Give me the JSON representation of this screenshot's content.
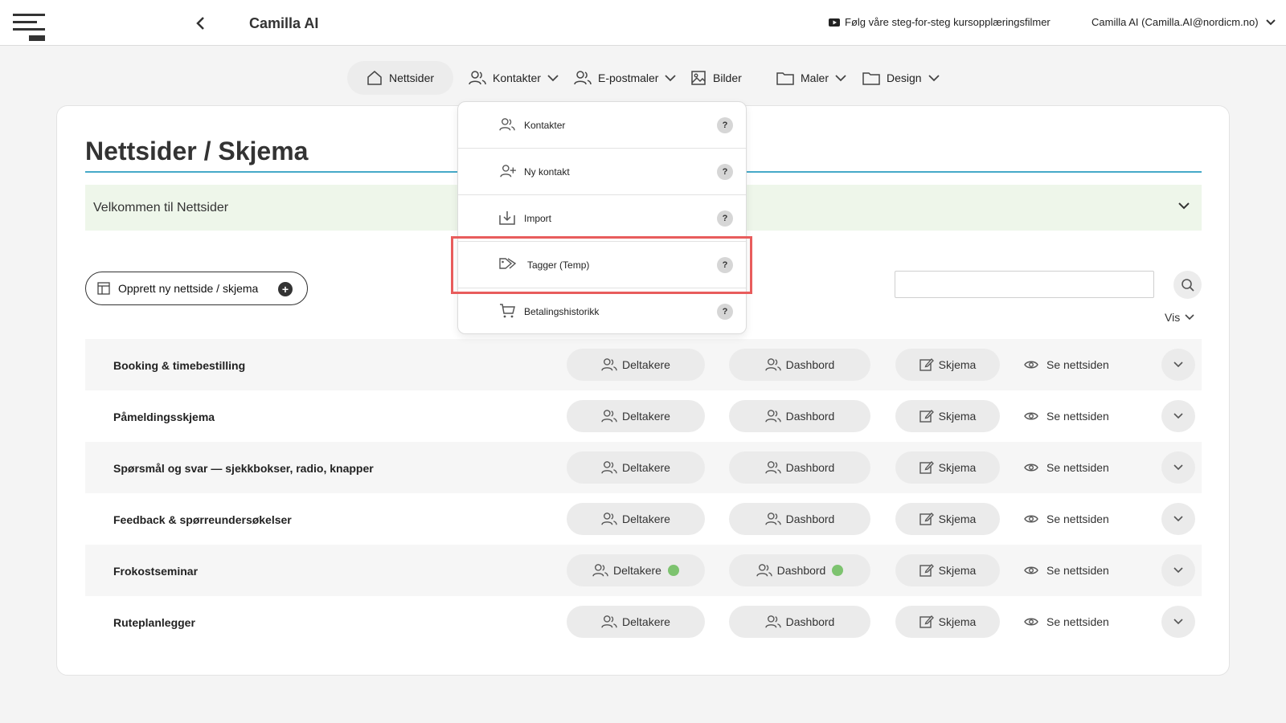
{
  "header": {
    "app_title": "Camilla AI",
    "tutorial_link": "Følg våre steg-for-steg kursopplæringsfilmer",
    "user_label": "Camilla AI (Camilla.AI@nordicm.no)"
  },
  "nav": {
    "items": [
      {
        "label": "Nettsider",
        "icon": "home-icon"
      },
      {
        "label": "Kontakter",
        "icon": "users-icon"
      },
      {
        "label": "E-postmaler",
        "icon": "users-icon"
      },
      {
        "label": "Bilder",
        "icon": "image-icon"
      },
      {
        "label": "Maler",
        "icon": "folder-icon"
      },
      {
        "label": "Design",
        "icon": "folder-icon"
      }
    ]
  },
  "dropdown": {
    "items": [
      {
        "label": "Kontakter",
        "icon": "users-icon",
        "help": "?"
      },
      {
        "label": "Ny kontakt",
        "icon": "user-plus-icon",
        "help": "?"
      },
      {
        "label": "Import",
        "icon": "import-icon",
        "help": "?"
      },
      {
        "label": "Tagger (Temp)",
        "icon": "tags-icon",
        "help": "?"
      },
      {
        "label": "Betalingshistorikk",
        "icon": "cart-icon",
        "help": "?"
      }
    ]
  },
  "main": {
    "title": "Nettsider / Skjema",
    "welcome": "Velkommen til Nettsider",
    "create_button": "Opprett ny nettside / skjema",
    "search_value": "",
    "vis_label": "Vis"
  },
  "rows": [
    {
      "name": "Booking & timebestilling",
      "deltakere": "Deltakere",
      "dashbord": "Dashbord",
      "skjema": "Skjema",
      "view": "Se nettsiden",
      "active_dots": false
    },
    {
      "name": "Påmeldingsskjema",
      "deltakere": "Deltakere",
      "dashbord": "Dashbord",
      "skjema": "Skjema",
      "view": "Se nettsiden",
      "active_dots": false
    },
    {
      "name": "Spørsmål og svar — sjekkbokser, radio, knapper",
      "deltakere": "Deltakere",
      "dashbord": "Dashbord",
      "skjema": "Skjema",
      "view": "Se nettsiden",
      "active_dots": false
    },
    {
      "name": "Feedback & spørreundersøkelser",
      "deltakere": "Deltakere",
      "dashbord": "Dashbord",
      "skjema": "Skjema",
      "view": "Se nettsiden",
      "active_dots": false
    },
    {
      "name": "Frokostseminar",
      "deltakere": "Deltakere",
      "dashbord": "Dashbord",
      "skjema": "Skjema",
      "view": "Se nettsiden",
      "active_dots": true
    },
    {
      "name": "Ruteplanlegger",
      "deltakere": "Deltakere",
      "dashbord": "Dashbord",
      "skjema": "Skjema",
      "view": "Se nettsiden",
      "active_dots": false
    }
  ],
  "colors": {
    "accent_rule": "#46a9c8",
    "welcome_bg": "#eef6ea",
    "status_dot": "#7dc36f",
    "highlight": "#e85c5c"
  }
}
